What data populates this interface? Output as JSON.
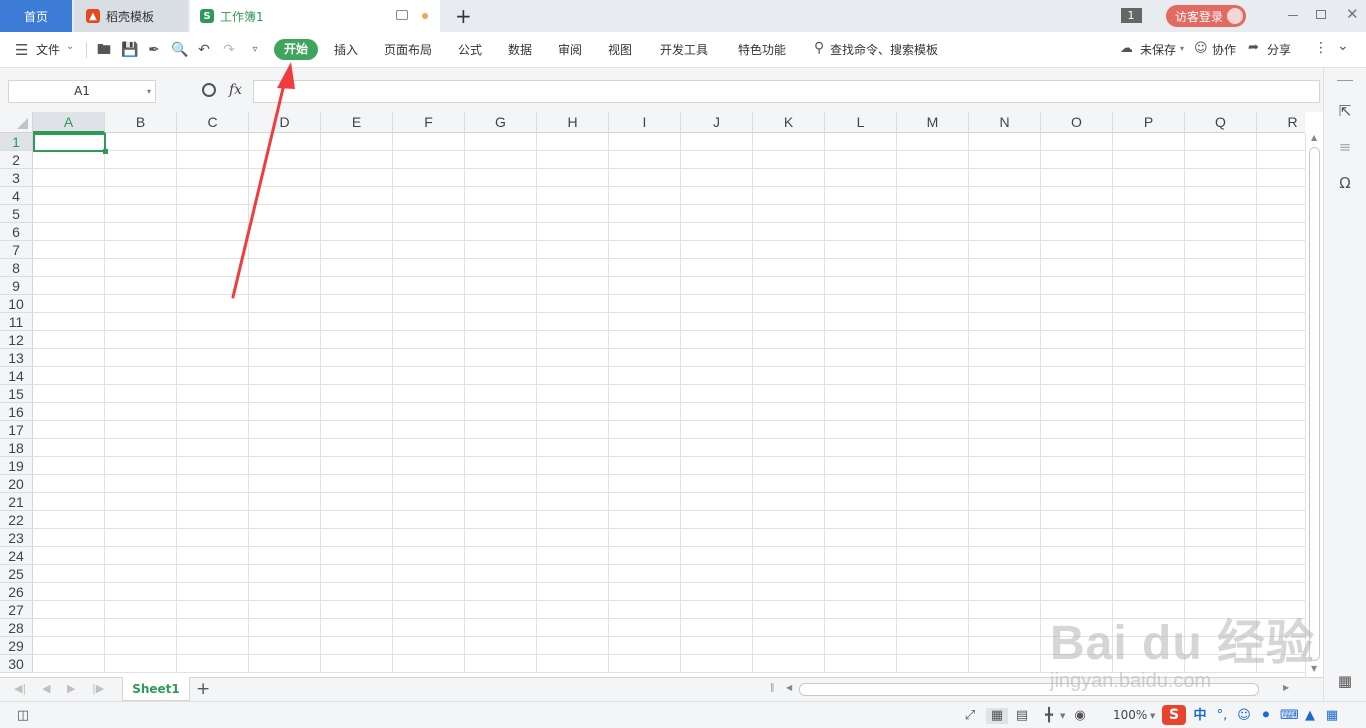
{
  "tabs": {
    "home": "首页",
    "daoke": "稻壳模板",
    "workbook": "工作簿1",
    "workbook_icon": "S",
    "new_tab": "+"
  },
  "titlebar": {
    "window_count": "1",
    "login": "访客登录"
  },
  "menu": {
    "file": "文件",
    "start": "开始",
    "items": [
      "插入",
      "页面布局",
      "公式",
      "数据",
      "审阅",
      "视图",
      "开发工具",
      "特色功能"
    ],
    "search": "查找命令、搜索模板",
    "unsaved": "未保存",
    "collab": "协作",
    "share": "分享"
  },
  "formula": {
    "cell_ref": "A1",
    "fx": "fx",
    "value": ""
  },
  "grid": {
    "columns": [
      "A",
      "B",
      "C",
      "D",
      "E",
      "F",
      "G",
      "H",
      "I",
      "J",
      "K",
      "L",
      "M",
      "N",
      "O",
      "P",
      "Q",
      "R"
    ],
    "rows": [
      "1",
      "2",
      "3",
      "4",
      "5",
      "6",
      "7",
      "8",
      "9",
      "10",
      "11",
      "12",
      "13",
      "14",
      "15",
      "16",
      "17",
      "18",
      "19",
      "20",
      "21",
      "22",
      "23",
      "24",
      "25",
      "26",
      "27",
      "28",
      "29",
      "30"
    ],
    "selected_cell": "A1"
  },
  "sheets": {
    "active": "Sheet1",
    "add": "+"
  },
  "status": {
    "zoom": "100%"
  },
  "watermark": {
    "brand": "Bai du 经验",
    "url": "jingyan.baidu.com"
  },
  "colors": {
    "accent_green": "#3ea55c",
    "home_tab_blue": "#3c7cd7",
    "arrow_red": "#f03c3c"
  }
}
